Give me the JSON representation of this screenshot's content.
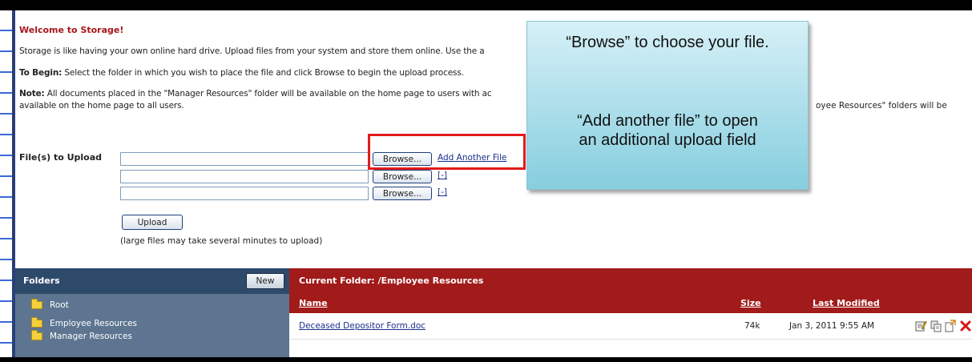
{
  "intro": {
    "welcome": "Welcome to Storage!",
    "line1": "Storage is like having your own online hard drive. Upload files from your system and store them online. Use the a",
    "line2_lead": "To Begin:",
    "line2_text": " Select the folder in which you wish to place the file and click Browse to begin the upload process.",
    "line3_lead": "Note:",
    "line3_text": " All documents placed in the \"Manager Resources\" folder will be available on the home page to users with ac",
    "line3_right": "oyee Resources\" folders will be",
    "line4": "available on the home page to all users."
  },
  "upload": {
    "label": "File(s) to Upload",
    "browse_label": "Browse...",
    "add_another": "Add Another File",
    "remove_label": "[-]",
    "upload_button": "Upload",
    "note": "(large files may take several minutes to upload)"
  },
  "callout": {
    "text1": "“Browse” to choose your file.",
    "text2": "“Add another file” to open an additional upload field"
  },
  "folders": {
    "title": "Folders",
    "new_button": "New",
    "items": [
      "Root",
      "Employee Resources",
      "Manager Resources"
    ]
  },
  "files": {
    "current_folder": "Current Folder: /Employee Resources",
    "columns": {
      "name": "Name",
      "size": "Size",
      "modified": "Last Modified"
    },
    "rows": [
      {
        "name": "Deceased Depositor Form.doc",
        "size": "74k",
        "modified": "Jan 3, 2011 9:55 AM"
      }
    ]
  },
  "colors": {
    "accent_red": "#a11b1b",
    "folder_blue": "#2e4a6b",
    "callout_bg": "#9fd8e6",
    "highlight_red": "#e31b1b"
  }
}
